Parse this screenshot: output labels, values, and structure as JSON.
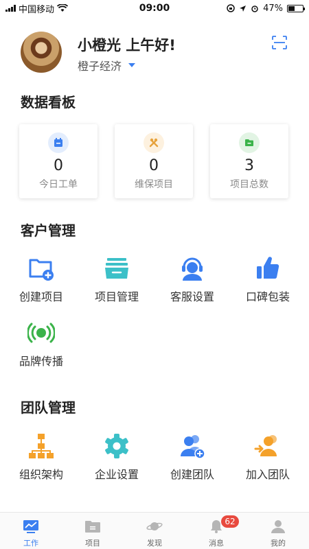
{
  "status_bar": {
    "carrier": "中国移动",
    "time": "09:00",
    "battery": "47%",
    "battery_level": 0.47
  },
  "header": {
    "greeting": "小橙光 上午好!",
    "company": "橙子经济"
  },
  "dashboard": {
    "title": "数据看板",
    "cards": [
      {
        "value": "0",
        "label": "今日工单",
        "icon": "calendar-icon",
        "color": "#3b7ff0",
        "bg": "#e3edfd"
      },
      {
        "value": "0",
        "label": "维保项目",
        "icon": "tools-icon",
        "color": "#e6a23c",
        "bg": "#fdf1df"
      },
      {
        "value": "3",
        "label": "项目总数",
        "icon": "folder-icon",
        "color": "#3bb34a",
        "bg": "#e2f4e4"
      }
    ]
  },
  "customer": {
    "title": "客户管理",
    "items": [
      {
        "label": "创建项目",
        "icon": "folder-add-icon"
      },
      {
        "label": "项目管理",
        "icon": "inbox-tray-icon"
      },
      {
        "label": "客服设置",
        "icon": "headset-agent-icon"
      },
      {
        "label": "口碑包装",
        "icon": "thumbs-up-icon"
      },
      {
        "label": "品牌传播",
        "icon": "broadcast-icon"
      }
    ]
  },
  "team": {
    "title": "团队管理",
    "items": [
      {
        "label": "组织架构",
        "icon": "org-chart-icon"
      },
      {
        "label": "企业设置",
        "icon": "gear-icon"
      },
      {
        "label": "创建团队",
        "icon": "users-add-icon"
      },
      {
        "label": "加入团队",
        "icon": "users-join-icon"
      }
    ]
  },
  "tabbar": {
    "tabs": [
      {
        "label": "工作",
        "icon": "chart-icon",
        "active": true
      },
      {
        "label": "项目",
        "icon": "folder-icon"
      },
      {
        "label": "发现",
        "icon": "planet-icon"
      },
      {
        "label": "消息",
        "icon": "bell-icon",
        "badge": "62"
      },
      {
        "label": "我的",
        "icon": "user-icon"
      }
    ]
  },
  "colors": {
    "accent": "#3b7ff0",
    "orange": "#f4a12a",
    "teal": "#3cc0c8",
    "green": "#3bb34a",
    "badge": "#e84a3f"
  }
}
